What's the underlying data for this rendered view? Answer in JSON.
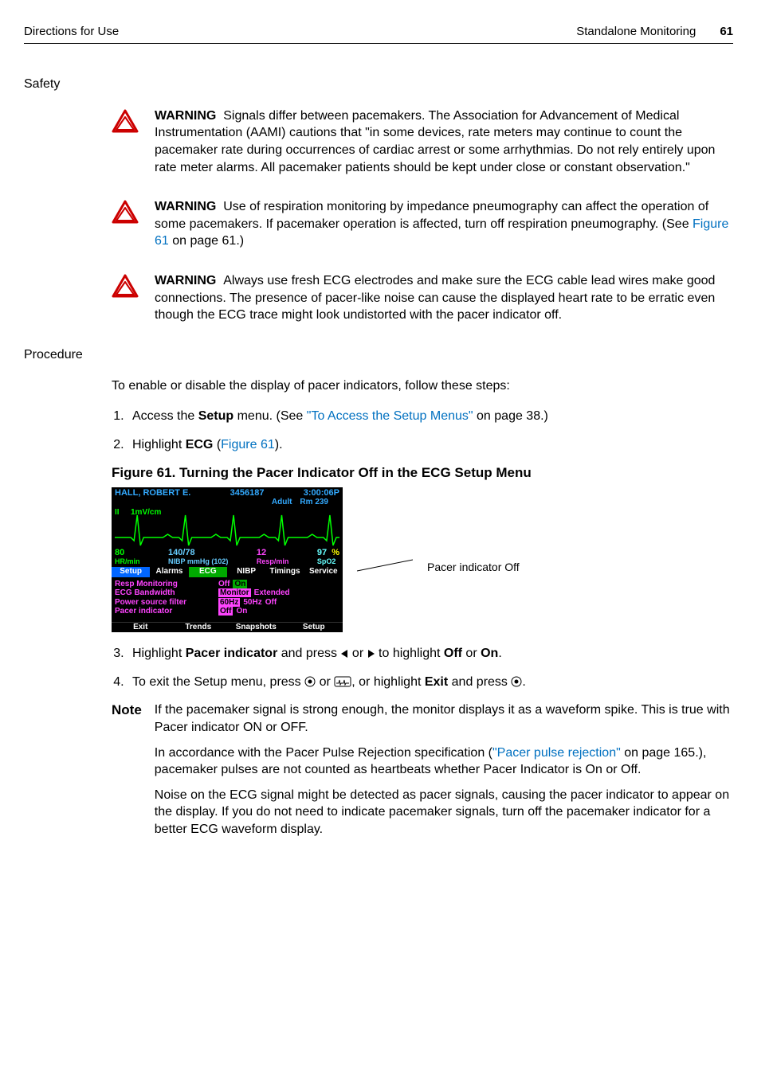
{
  "header": {
    "left": "Directions for Use",
    "section": "Standalone Monitoring",
    "page": "61"
  },
  "safety": {
    "heading": "Safety",
    "warnings": [
      {
        "label": "WARNING",
        "text": "Signals differ between pacemakers. The Association for Advancement of Medical Instrumentation (AAMI) cautions that \"in some devices, rate meters may continue to count the pacemaker rate during occurrences of cardiac arrest or some arrhythmias. Do not rely entirely upon rate meter alarms. All pacemaker patients should be kept under close or constant observation.\""
      },
      {
        "label": "WARNING",
        "text_before_link": "Use of respiration monitoring by impedance pneumography can affect the operation of some pacemakers. If pacemaker operation is affected, turn off respiration pneumography. (See ",
        "link": "Figure 61",
        "text_after_link": " on page 61.)"
      },
      {
        "label": "WARNING",
        "text": "Always use fresh ECG electrodes and make sure the ECG cable lead wires make good connections. The presence of pacer-like noise can cause the displayed heart rate to be erratic even though the ECG trace might look undistorted with the pacer indicator off."
      }
    ]
  },
  "procedure": {
    "heading": "Procedure",
    "intro": "To enable or disable the display of pacer indicators, follow these steps:",
    "step1_a": "Access the ",
    "step1_b": "Setup",
    "step1_c": " menu. (See ",
    "step1_link": "\"To Access the Setup Menus\"",
    "step1_d": " on page 38.)",
    "step2_a": "Highlight ",
    "step2_b": "ECG",
    "step2_c": " (",
    "step2_link": "Figure 61",
    "step2_d": ").",
    "fig_caption": "Figure 61.  Turning the Pacer Indicator Off in the ECG Setup Menu",
    "callout": "Pacer indicator Off",
    "step3_a": "Highlight ",
    "step3_b": "Pacer indicator",
    "step3_c": " and press ",
    "step3_d": " or ",
    "step3_e": " to highlight ",
    "step3_f": "Off",
    "step3_g": " or ",
    "step3_h": "On",
    "step3_i": ".",
    "step4_a": "To exit the Setup menu, press ",
    "step4_b": " or ",
    "step4_c": ", or highlight ",
    "step4_d": "Exit",
    "step4_e": " and press ",
    "step4_f": "."
  },
  "monitor": {
    "patient": "HALL, ROBERT E.",
    "id": "3456187",
    "time": "3:00:06P",
    "type": "Adult",
    "room": "Rm 239",
    "lead": "II",
    "scale": "1mV/cm",
    "hr_val": "80",
    "hr_lab": "HR/min",
    "nibp_val": "140/78",
    "nibp_lab": "NIBP mmHg (102)",
    "resp_val": "12",
    "resp_lab": "Resp/min",
    "spo2_val": "97",
    "spo2_pct": "%",
    "spo2_lab": "SpO2",
    "tabs": [
      "Setup",
      "Alarms",
      "ECG",
      "NIBP",
      "Timings",
      "Service"
    ],
    "settings": [
      {
        "label": "Resp Monitoring",
        "opts": [
          "Off",
          "On"
        ],
        "sel": 1,
        "cls": "g"
      },
      {
        "label": "ECG Bandwidth",
        "opts": [
          "Monitor",
          "Extended"
        ],
        "sel": 0,
        "cls": "m"
      },
      {
        "label": "Power source filter",
        "opts": [
          "60Hz",
          "50Hz",
          "Off"
        ],
        "sel": 0,
        "cls": "m"
      },
      {
        "label": "Pacer indicator",
        "opts": [
          "Off",
          "On"
        ],
        "sel": 0,
        "cls": "m"
      }
    ],
    "bottom": [
      "Exit",
      "Trends",
      "Snapshots",
      "Setup"
    ]
  },
  "note": {
    "label": "Note",
    "p1": "If the pacemaker signal is strong enough, the monitor displays it as a waveform spike. This is true with Pacer indicator ON or OFF.",
    "p2_a": "In accordance with the Pacer Pulse Rejection specification (",
    "p2_link": "\"Pacer pulse rejection\"",
    "p2_b": " on page 165.), pacemaker pulses are not counted as heartbeats whether Pacer Indicator is On or Off.",
    "p3": "Noise on the ECG signal might be detected as pacer signals, causing the pacer indicator to appear on the display. If you do not need to indicate pacemaker signals, turn off the pacemaker indicator for a better ECG waveform display."
  }
}
